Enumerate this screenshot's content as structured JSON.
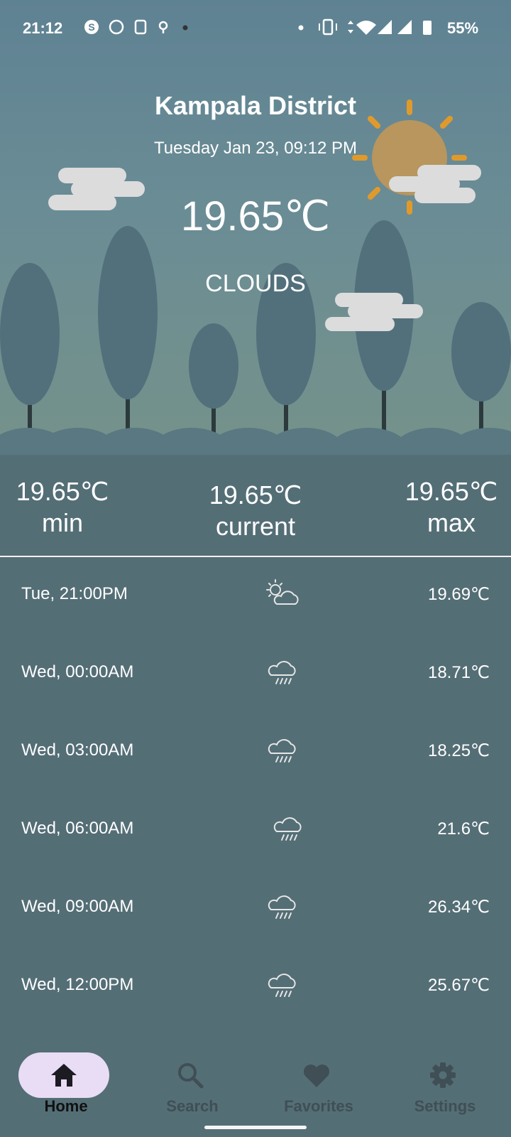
{
  "status_bar": {
    "time": "21:12",
    "battery": "55%",
    "icons": [
      "skype-icon",
      "whatsapp-icon",
      "app-icon",
      "location-icon",
      "vibrate-icon",
      "wifi-icon",
      "signal-icon"
    ]
  },
  "weather": {
    "city": "Kampala District",
    "date": "Tuesday Jan 23, 09:12 PM",
    "temperature": "19.65℃",
    "condition": "CLOUDS",
    "min_value": "19.65℃",
    "min_label": "min",
    "current_value": "19.65℃",
    "current_label": "current",
    "max_value": "19.65℃",
    "max_label": "max"
  },
  "forecast": [
    {
      "time": "Tue, 21:00PM",
      "icon": "partly-cloudy-icon",
      "temp": "19.69℃"
    },
    {
      "time": "Wed, 00:00AM",
      "icon": "rain-cloud-icon",
      "temp": "18.71℃"
    },
    {
      "time": "Wed, 03:00AM",
      "icon": "rain-cloud-icon",
      "temp": "18.25℃"
    },
    {
      "time": "Wed, 06:00AM",
      "icon": "rain-cloud-icon",
      "temp": "21.6℃"
    },
    {
      "time": "Wed, 09:00AM",
      "icon": "rain-cloud-icon",
      "temp": "26.34℃"
    },
    {
      "time": "Wed, 12:00PM",
      "icon": "rain-cloud-icon",
      "temp": "25.67℃"
    }
  ],
  "nav": [
    {
      "label": "Home",
      "icon": "home-icon",
      "active": true
    },
    {
      "label": "Search",
      "icon": "search-icon",
      "active": false
    },
    {
      "label": "Favorites",
      "icon": "heart-icon",
      "active": false
    },
    {
      "label": "Settings",
      "icon": "gear-icon",
      "active": false
    }
  ],
  "colors": {
    "background": "#546e76",
    "active_nav": "#e8ddf5",
    "sun": "#b8965e",
    "sun_rays": "#e09a2c",
    "cloud": "#dcdcdc"
  }
}
